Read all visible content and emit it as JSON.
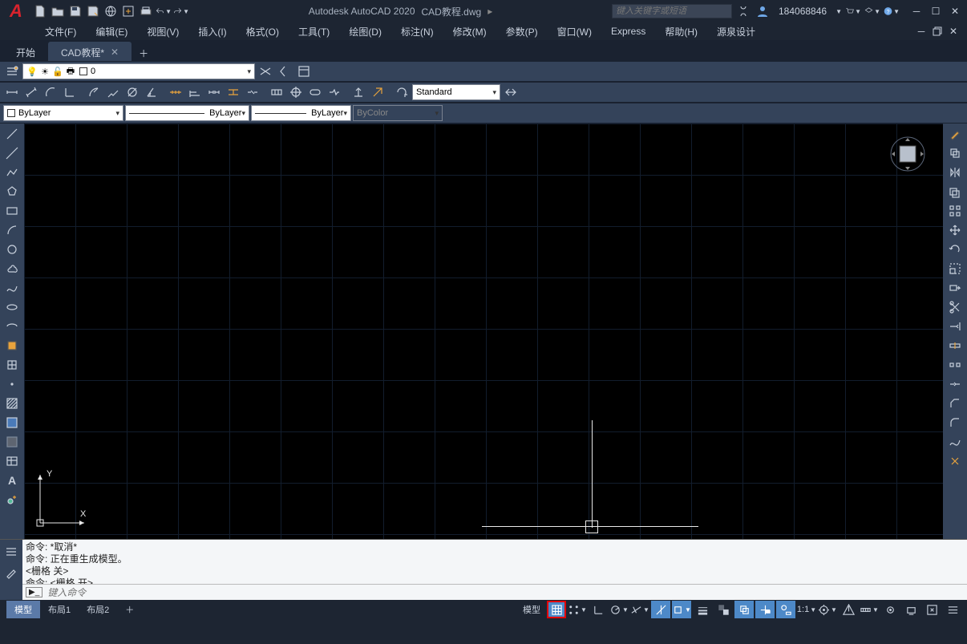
{
  "title": {
    "app": "Autodesk AutoCAD 2020",
    "doc": "CAD教程.dwg"
  },
  "search_placeholder": "键入关键字或短语",
  "user_id": "184068846",
  "menus": [
    "文件(F)",
    "编辑(E)",
    "视图(V)",
    "插入(I)",
    "格式(O)",
    "工具(T)",
    "绘图(D)",
    "标注(N)",
    "修改(M)",
    "参数(P)",
    "窗口(W)",
    "Express",
    "帮助(H)",
    "源泉设计"
  ],
  "tabs": [
    {
      "label": "开始",
      "active": false
    },
    {
      "label": "CAD教程*",
      "active": true
    }
  ],
  "layer_name": "0",
  "layer_dd": "ByLayer",
  "linetype": "ByLayer",
  "lineweight": "ByLayer",
  "plotstyle": "ByColor",
  "dimstyle": "Standard",
  "cmd_history": [
    "命令:  *取消*",
    "命令:  正在重生成模型。",
    "<栅格 关>",
    "命令:   <栅格 开>"
  ],
  "cmd_placeholder": "键入命令",
  "layout_tabs": [
    {
      "label": "模型",
      "active": true
    },
    {
      "label": "布局1",
      "active": false
    },
    {
      "label": "布局2",
      "active": false
    }
  ],
  "status_model": "模型",
  "status_scale": "1:1"
}
